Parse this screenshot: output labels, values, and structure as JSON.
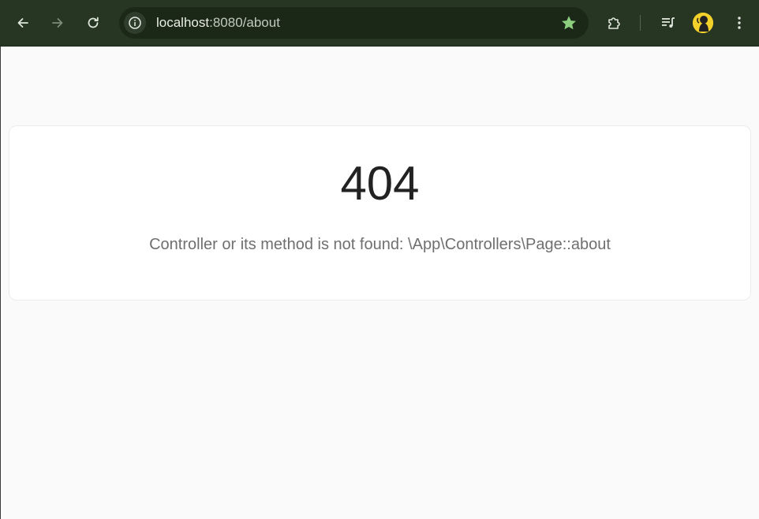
{
  "browser": {
    "url_host": "localhost",
    "url_rest": ":8080/about",
    "icons": {
      "back": "arrow-left-icon",
      "forward": "arrow-right-icon",
      "reload": "reload-icon",
      "site_info": "info-icon",
      "bookmark": "star-icon",
      "extensions": "puzzle-icon",
      "media": "media-queue-icon",
      "profile": "avatar",
      "menu": "kebab-menu-icon"
    },
    "colors": {
      "toolbar": "#263623",
      "omnibox": "#1b2818",
      "star": "#8ccf7e"
    }
  },
  "page": {
    "error_code": "404",
    "error_message": "Controller or its method is not found: \\App\\Controllers\\Page::about",
    "colors": {
      "background": "#fafafa",
      "card": "#ffffff",
      "code_text": "#222222",
      "message_text": "#6f6f6f"
    }
  }
}
